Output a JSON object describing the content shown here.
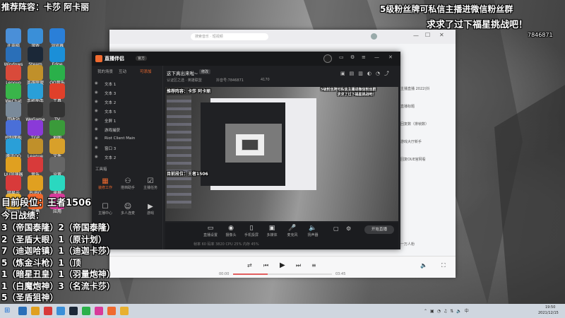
{
  "colors": {
    "accent": "#f06a2f",
    "stream_red": "#e25f5f",
    "app_bg": "#1f2023",
    "taskbar": "#cfd6df"
  },
  "overlay": {
    "top_left": "推荐阵容：卡莎 阿卡丽",
    "top_right_line1": "5级粉丝牌可私信主播进微信粉丝群",
    "top_right_line2": "求求了过下福星挑战吧！",
    "number": "7846871",
    "rank_line": "目前段位：王者1506",
    "record_title": "今日战绩：",
    "records": [
      "3（帝国泰隆）2（帝国泰隆）",
      "2（圣盾大眼）1（原计划）",
      "7（迪迦哈镇）1（迪迦卡莎）",
      "5（炼金斗枪）1（顶",
      "1（暗星丑皇）1（羽量炮神）",
      "1（白魔炮神）3（名流卡莎）",
      "5（圣盾狙神）"
    ]
  },
  "desktop_icons": [
    "此电脑",
    "Windows",
    "Lenovo",
    "WeChat",
    "回收站",
    "控制面板",
    "腾讯QQ",
    "UU加速器",
    "网易云",
    "Chrome",
    "游戏",
    "Steam",
    "英雄联盟",
    "手机助手",
    "WeGame",
    "TGP",
    "League",
    "音乐",
    "PUBG",
    "直播",
    "浏览器",
    "Edge",
    "QQ音乐",
    "工具",
    "TV",
    "地图",
    "文件",
    "设置",
    "录屏",
    "应用"
  ],
  "app": {
    "logo": "直播伴侣",
    "badge": "官方",
    "stream_title": "这下真出来啦~",
    "title_btn": "修改",
    "meta_area": "认证区之选 · 英雄联盟",
    "meta_id": "抖音号:7846871",
    "meta_count": "4170",
    "tabs": [
      "我的场景",
      "互动",
      "可添加"
    ],
    "sources": [
      "文本 1",
      "文本 3",
      "文本 2",
      "文本 5",
      "全屏 1",
      "游戏捕获",
      "Riot Client Main",
      "窗口 3",
      "文本 2"
    ],
    "tools_label": "工具箱",
    "tools": [
      "装修工作",
      "搭档助手",
      "主播任务",
      "主播中心",
      "多人连麦",
      "游戏"
    ],
    "preview_overlay_left": "推荐阵容：卡莎 阿卡丽",
    "preview_overlay_right": "5级粉丝牌可私信主播进微信粉丝群\n求求了过下福星挑战吧！",
    "bottom_controls": [
      "直播设置",
      "摄像头",
      "手机投屏",
      "多媒体",
      "麦克风",
      "扬声器"
    ],
    "start_btn": "开始直播",
    "status": "帧率 60  码率 3820  CPU 25%  内存 45%",
    "footer_text": "一万人粉"
  },
  "back_window": {
    "search_placeholder": "搜索音乐 · 短视频",
    "side_lines": [
      "主播直播 2022(抖",
      "直播标题",
      "回复数（排帧数）",
      "游戏大厅新手",
      "回复OUE官网看"
    ],
    "player_time_start": "00:00",
    "player_time_end": "03:45",
    "player_progress": 0.35
  },
  "taskbar": {
    "time": "19:50",
    "date": "2021/12/15"
  }
}
